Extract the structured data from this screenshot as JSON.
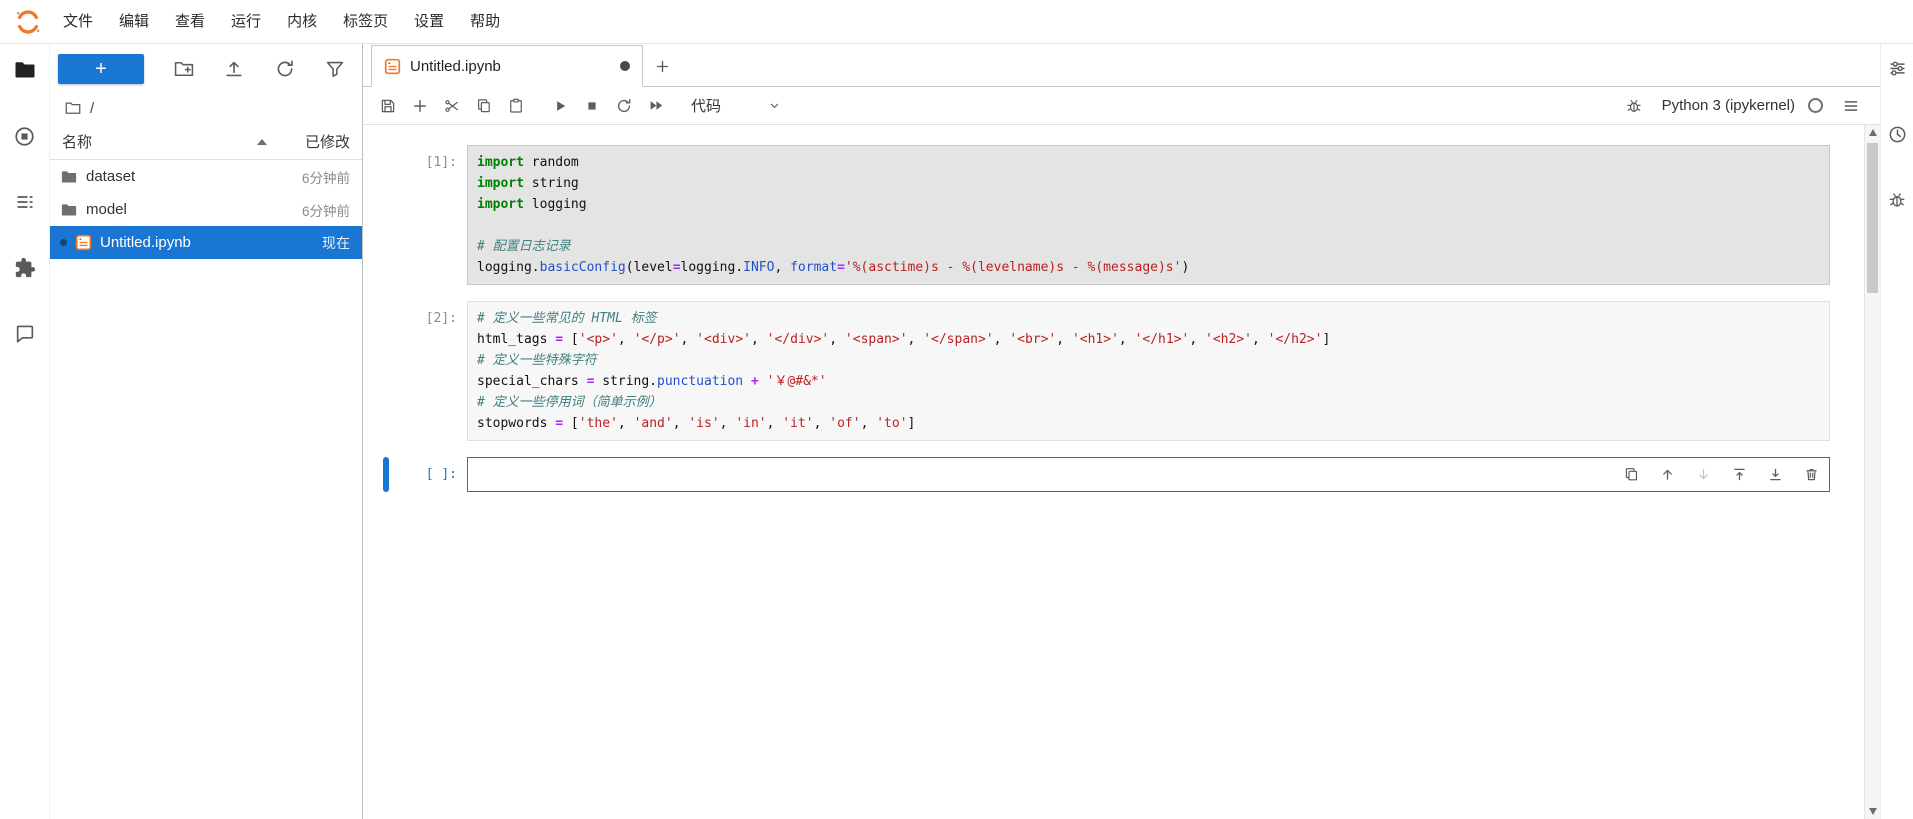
{
  "palette": {
    "accent": "#1976d2",
    "kw": "#008000",
    "cm": "#408080",
    "st": "#BA2121",
    "op": "#AA22FF",
    "fn": "#2050c8",
    "notebook_icon_orange": "#F37726"
  },
  "menu_bar": {
    "items": [
      "文件",
      "编辑",
      "查看",
      "运行",
      "内核",
      "标签页",
      "设置",
      "帮助"
    ]
  },
  "left_activity_bar": {
    "icons": [
      "file-browser",
      "running-sessions",
      "table-of-contents",
      "extension-manager",
      "chat"
    ]
  },
  "file_browser": {
    "new_launcher_label": "+",
    "breadcrumb_root": "/",
    "columns": {
      "name": "名称",
      "modified": "已修改"
    },
    "rows": [
      {
        "name": "dataset",
        "modified": "6分钟前",
        "type": "folder",
        "selected": false
      },
      {
        "name": "model",
        "modified": "6分钟前",
        "type": "folder",
        "selected": false
      },
      {
        "name": "Untitled.ipynb",
        "modified": "现在",
        "type": "notebook",
        "selected": true,
        "running": true
      }
    ]
  },
  "tab_bar": {
    "tabs": [
      {
        "title": "Untitled.ipynb",
        "dirty": true
      }
    ]
  },
  "nb_toolbar": {
    "cell_type": "代码",
    "kernel_name": "Python 3 (ipykernel)",
    "icons": [
      "save",
      "insert-cell",
      "cut",
      "copy",
      "paste",
      "run",
      "stop",
      "restart",
      "restart-run-all",
      "debugger",
      "kernel-status-idle",
      "menu"
    ]
  },
  "notebook": {
    "cell_toolbar_icons": [
      "duplicate",
      "move-up",
      "move-down",
      "insert-above",
      "insert-below",
      "delete"
    ],
    "cells": [
      {
        "prompt": "[1]:",
        "state": "selected",
        "lines": [
          [
            {
              "t": "kw",
              "v": "import"
            },
            {
              "t": "pl",
              "v": " random"
            }
          ],
          [
            {
              "t": "kw",
              "v": "import"
            },
            {
              "t": "pl",
              "v": " string"
            }
          ],
          [
            {
              "t": "kw",
              "v": "import"
            },
            {
              "t": "pl",
              "v": " logging"
            }
          ],
          [],
          [
            {
              "t": "cm",
              "v": "# 配置日志记录"
            }
          ],
          [
            {
              "t": "pl",
              "v": "logging."
            },
            {
              "t": "fn",
              "v": "basicConfig"
            },
            {
              "t": "pl",
              "v": "(level"
            },
            {
              "t": "op",
              "v": "="
            },
            {
              "t": "pl",
              "v": "logging."
            },
            {
              "t": "fn",
              "v": "INFO"
            },
            {
              "t": "pl",
              "v": ", "
            },
            {
              "t": "fn",
              "v": "format"
            },
            {
              "t": "op",
              "v": "="
            },
            {
              "t": "st",
              "v": "'%(asctime)s - %(levelname)s - %(message)s'"
            },
            {
              "t": "pl",
              "v": ")"
            }
          ]
        ]
      },
      {
        "prompt": "[2]:",
        "state": "normal",
        "lines": [
          [
            {
              "t": "cm",
              "v": "# 定义一些常见的 HTML 标签"
            }
          ],
          [
            {
              "t": "pl",
              "v": "html_tags "
            },
            {
              "t": "op",
              "v": "="
            },
            {
              "t": "pl",
              "v": " ["
            },
            {
              "t": "st",
              "v": "'<p>'"
            },
            {
              "t": "pl",
              "v": ", "
            },
            {
              "t": "st",
              "v": "'</p>'"
            },
            {
              "t": "pl",
              "v": ", "
            },
            {
              "t": "st",
              "v": "'<div>'"
            },
            {
              "t": "pl",
              "v": ", "
            },
            {
              "t": "st",
              "v": "'</div>'"
            },
            {
              "t": "pl",
              "v": ", "
            },
            {
              "t": "st",
              "v": "'<span>'"
            },
            {
              "t": "pl",
              "v": ", "
            },
            {
              "t": "st",
              "v": "'</span>'"
            },
            {
              "t": "pl",
              "v": ", "
            },
            {
              "t": "st",
              "v": "'<br>'"
            },
            {
              "t": "pl",
              "v": ", "
            },
            {
              "t": "st",
              "v": "'<h1>'"
            },
            {
              "t": "pl",
              "v": ", "
            },
            {
              "t": "st",
              "v": "'</h1>'"
            },
            {
              "t": "pl",
              "v": ", "
            },
            {
              "t": "st",
              "v": "'<h2>'"
            },
            {
              "t": "pl",
              "v": ", "
            },
            {
              "t": "st",
              "v": "'</h2>'"
            },
            {
              "t": "pl",
              "v": "]"
            }
          ],
          [
            {
              "t": "cm",
              "v": "# 定义一些特殊字符"
            }
          ],
          [
            {
              "t": "pl",
              "v": "special_chars "
            },
            {
              "t": "op",
              "v": "="
            },
            {
              "t": "pl",
              "v": " string."
            },
            {
              "t": "fn",
              "v": "punctuation"
            },
            {
              "t": "pl",
              "v": " "
            },
            {
              "t": "op",
              "v": "+"
            },
            {
              "t": "pl",
              "v": " "
            },
            {
              "t": "st",
              "v": "'￥@#&*'"
            }
          ],
          [
            {
              "t": "cm",
              "v": "# 定义一些停用词（简单示例）"
            }
          ],
          [
            {
              "t": "pl",
              "v": "stopwords "
            },
            {
              "t": "op",
              "v": "="
            },
            {
              "t": "pl",
              "v": " ["
            },
            {
              "t": "st",
              "v": "'the'"
            },
            {
              "t": "pl",
              "v": ", "
            },
            {
              "t": "st",
              "v": "'and'"
            },
            {
              "t": "pl",
              "v": ", "
            },
            {
              "t": "st",
              "v": "'is'"
            },
            {
              "t": "pl",
              "v": ", "
            },
            {
              "t": "st",
              "v": "'in'"
            },
            {
              "t": "pl",
              "v": ", "
            },
            {
              "t": "st",
              "v": "'it'"
            },
            {
              "t": "pl",
              "v": ", "
            },
            {
              "t": "st",
              "v": "'of'"
            },
            {
              "t": "pl",
              "v": ", "
            },
            {
              "t": "st",
              "v": "'to'"
            },
            {
              "t": "pl",
              "v": "]"
            }
          ]
        ]
      },
      {
        "prompt": "[ ]:",
        "state": "active",
        "lines": [
          []
        ]
      }
    ]
  },
  "right_activity_bar": {
    "icons": [
      "property-inspector",
      "usage-monitor",
      "debugger"
    ]
  }
}
